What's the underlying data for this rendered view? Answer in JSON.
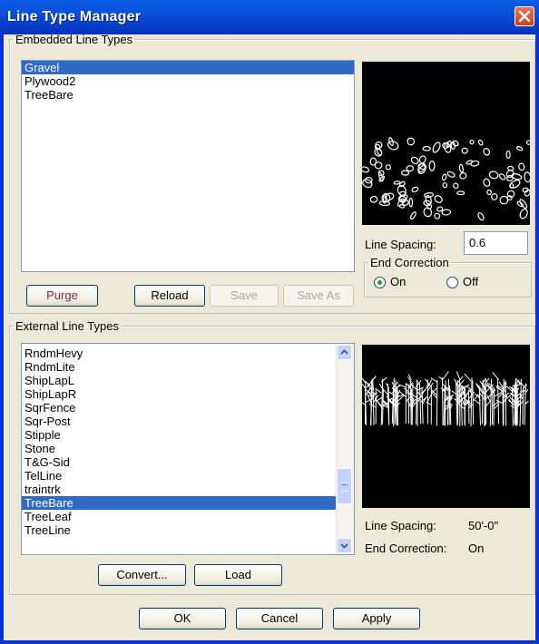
{
  "window": {
    "title": "Line Type Manager"
  },
  "embedded": {
    "legend": "Embedded Line Types",
    "items": [
      {
        "label": "Gravel",
        "selected": true
      },
      {
        "label": "Plywood2",
        "selected": false
      },
      {
        "label": "TreeBare",
        "selected": false
      }
    ],
    "line_spacing_label": "Line Spacing:",
    "line_spacing_value": "0.6",
    "end_correction_legend": "End Correction",
    "radio_on_label": "On",
    "radio_off_label": "Off",
    "end_correction_selected": "On",
    "buttons": {
      "purge": "Purge",
      "reload": "Reload",
      "save": "Save",
      "save_as": "Save As"
    }
  },
  "external": {
    "legend": "External Line Types",
    "items": [
      {
        "label": "RndmHevy",
        "selected": false
      },
      {
        "label": "RndmLite",
        "selected": false
      },
      {
        "label": "ShipLapL",
        "selected": false
      },
      {
        "label": "ShipLapR",
        "selected": false
      },
      {
        "label": "SqrFence",
        "selected": false
      },
      {
        "label": "Sqr-Post",
        "selected": false
      },
      {
        "label": "Stipple",
        "selected": false
      },
      {
        "label": "Stone",
        "selected": false
      },
      {
        "label": "T&G-Sid",
        "selected": false
      },
      {
        "label": "TelLine",
        "selected": false
      },
      {
        "label": "traintrk",
        "selected": false
      },
      {
        "label": "TreeBare",
        "selected": true
      },
      {
        "label": "TreeLeaf",
        "selected": false
      },
      {
        "label": "TreeLine",
        "selected": false
      }
    ],
    "line_spacing_label": "Line Spacing:",
    "line_spacing_value": "50'-0\"",
    "end_correction_label": "End Correction:",
    "end_correction_value": "On",
    "buttons": {
      "convert": "Convert...",
      "load": "Load"
    }
  },
  "footer": {
    "ok": "OK",
    "cancel": "Cancel",
    "apply": "Apply"
  },
  "icons": {
    "close": "close-icon",
    "scroll_up": "chevron-up-icon",
    "scroll_down": "chevron-down-icon"
  },
  "colors": {
    "title_bar": "#0a4fd8",
    "selection": "#316ac5",
    "dialog_bg": "#ece9d8",
    "close_button": "#d3401b"
  }
}
